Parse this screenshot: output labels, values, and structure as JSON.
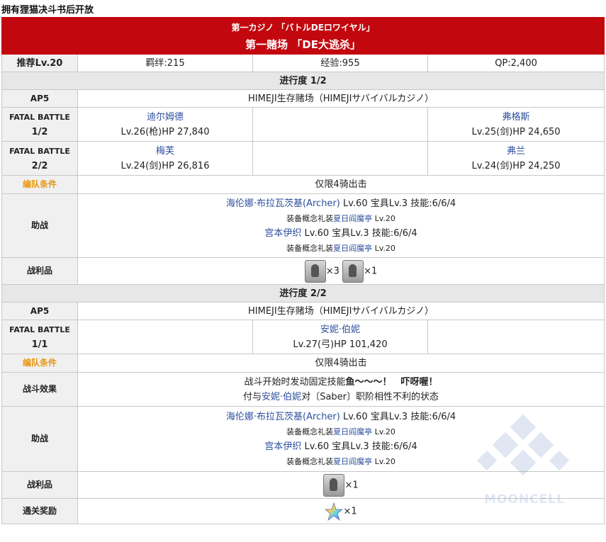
{
  "unlock_note": "拥有狸猫决斗书后开放",
  "header": {
    "jp_title": "第一カジノ 「バトルDEロワイヤル」",
    "cn_title": "第一赌场 「DE大逃杀」"
  },
  "summary": {
    "rec_label": "推荐Lv.20",
    "bond": "羁绊:215",
    "exp": "经验:955",
    "qp": "QP:2,400"
  },
  "stage1": {
    "title": "进行度 1/2",
    "ap": "AP5",
    "location": "HIMEJI生存赌场（HIMEJIサバイバルカジノ）",
    "battle1_label": "FATAL BATTLE",
    "battle1_num": "1/2",
    "b1_e1_name": "迪尔姆德",
    "b1_e1_stats": "Lv.26(枪)HP 27,840",
    "b1_e2_name": "弗格斯",
    "b1_e2_stats": "Lv.25(剑)HP 24,650",
    "battle2_label": "FATAL BATTLE",
    "battle2_num": "2/2",
    "b2_e1_name": "梅芙",
    "b2_e1_stats": "Lv.24(剑)HP 26,816",
    "b2_e2_name": "弗兰",
    "b2_e2_stats": "Lv.24(剑)HP 24,250",
    "formation_label": "编队条件",
    "formation": "仅限4骑出击",
    "support_label": "助战",
    "sup1_name": "海伦娜·布拉瓦茨基(Archer)",
    "sup1_stats": " Lv.60 宝具Lv.3 技能:6/6/4",
    "sup1_ce_prefix": "装备概念礼装",
    "sup1_ce_name": "夏日阎魔亭",
    "sup1_ce_lv": " Lv.20",
    "sup2_name": "宫本伊织",
    "sup2_stats": " Lv.60 宝具Lv.3 技能:6/6/4",
    "sup2_ce_prefix": "装备概念礼装",
    "sup2_ce_name": "夏日阎魔亭",
    "sup2_ce_lv": " Lv.20",
    "drops_label": "战利品",
    "drop1_count": "×3",
    "drop2_count": "×1"
  },
  "stage2": {
    "title": "进行度 2/2",
    "ap": "AP5",
    "location": "HIMEJI生存赌场（HIMEJIサバイバルカジノ）",
    "battle_label": "FATAL BATTLE",
    "battle_num": "1/1",
    "enemy_name": "安妮·伯妮",
    "enemy_stats": "Lv.27(弓)HP 101,420",
    "formation_label": "编队条件",
    "formation": "仅限4骑出击",
    "effect_label": "战斗效果",
    "effect_line1_a": "战斗开始时发动固定技能",
    "effect_line1_b": "鱼～～～！　吓呀喔！",
    "effect_line2_a": "付与",
    "effect_line2_link": "安妮·伯妮",
    "effect_line2_b": "对〔Saber〕职阶相性不利的状态",
    "support_label": "助战",
    "sup1_name": "海伦娜·布拉瓦茨基(Archer)",
    "sup1_stats": " Lv.60 宝具Lv.3 技能:6/6/4",
    "sup1_ce_prefix": "装备概念礼装",
    "sup1_ce_name": "夏日阎魔亭",
    "sup1_ce_lv": " Lv.20",
    "sup2_name": "宫本伊织",
    "sup2_stats": " Lv.60 宝具Lv.3 技能:6/6/4",
    "sup2_ce_prefix": "装备概念礼装",
    "sup2_ce_name": "夏日阎魔亭",
    "sup2_ce_lv": " Lv.20",
    "drops_label": "战利品",
    "drop1_count": "×1",
    "reward_label": "通关奖励",
    "reward_count": "×1"
  },
  "watermark": "MOONCELL",
  "colors": {
    "header_bg": "#c2070e",
    "link": "#2d4f9e",
    "formation_label": "#e8960f"
  }
}
